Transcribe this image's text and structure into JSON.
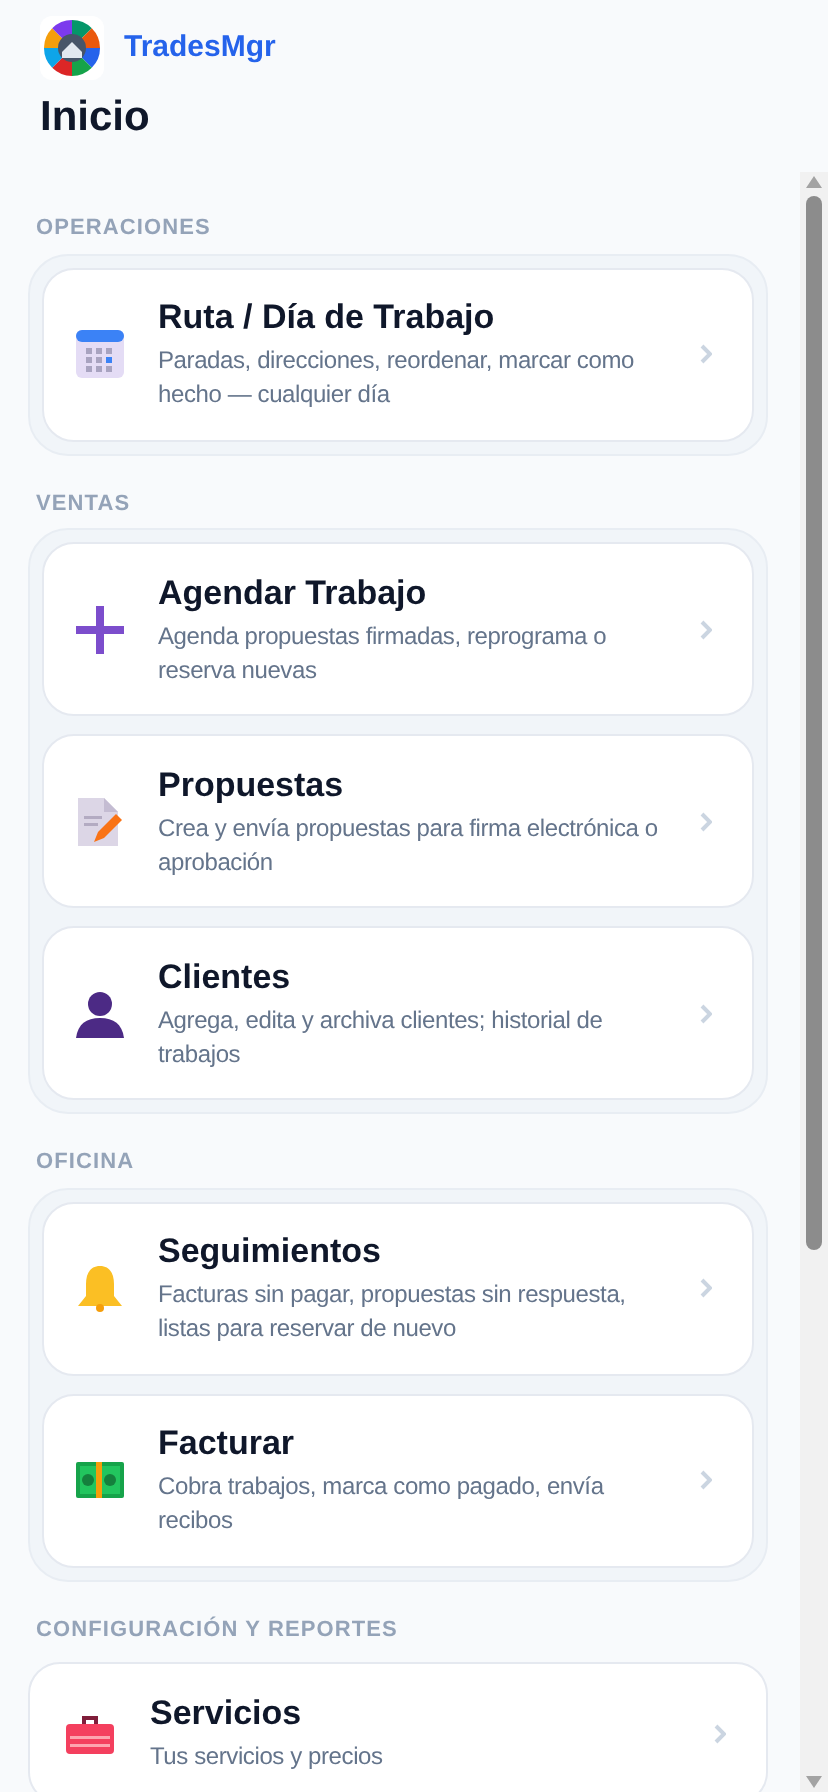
{
  "app": {
    "brand": "TradesMgr",
    "title": "Inicio"
  },
  "sections": [
    {
      "kind": "group",
      "label": "OPERACIONES",
      "items": [
        {
          "kind": "calendar",
          "title": "Ruta / Día de Trabajo",
          "description": "Paradas, direcciones, reordenar, marcar como hecho — cualquier día"
        }
      ]
    },
    {
      "kind": "group",
      "label": "VENTAS",
      "items": [
        {
          "kind": "plus",
          "title": "Agendar Trabajo",
          "description": "Agenda propuestas firmadas, reprograma o reserva nuevas"
        },
        {
          "kind": "document",
          "title": "Propuestas",
          "description": "Crea y envía propuestas para firma electrónica o aprobación"
        },
        {
          "kind": "person",
          "title": "Clientes",
          "description": "Agrega, edita y archiva clientes; historial de trabajos"
        }
      ]
    },
    {
      "kind": "group",
      "label": "OFICINA",
      "items": [
        {
          "kind": "bell",
          "title": "Seguimientos",
          "description": "Facturas sin pagar, propuestas sin respuesta, listas para reservar de nuevo"
        },
        {
          "kind": "money",
          "title": "Facturar",
          "description": "Cobra trabajos, marca como pagado, envía recibos"
        }
      ]
    },
    {
      "kind": "plain",
      "label": "CONFIGURACIÓN Y REPORTES",
      "items": [
        {
          "kind": "toolbox",
          "title": "Servicios",
          "description": "Tus servicios y precios"
        }
      ]
    }
  ]
}
